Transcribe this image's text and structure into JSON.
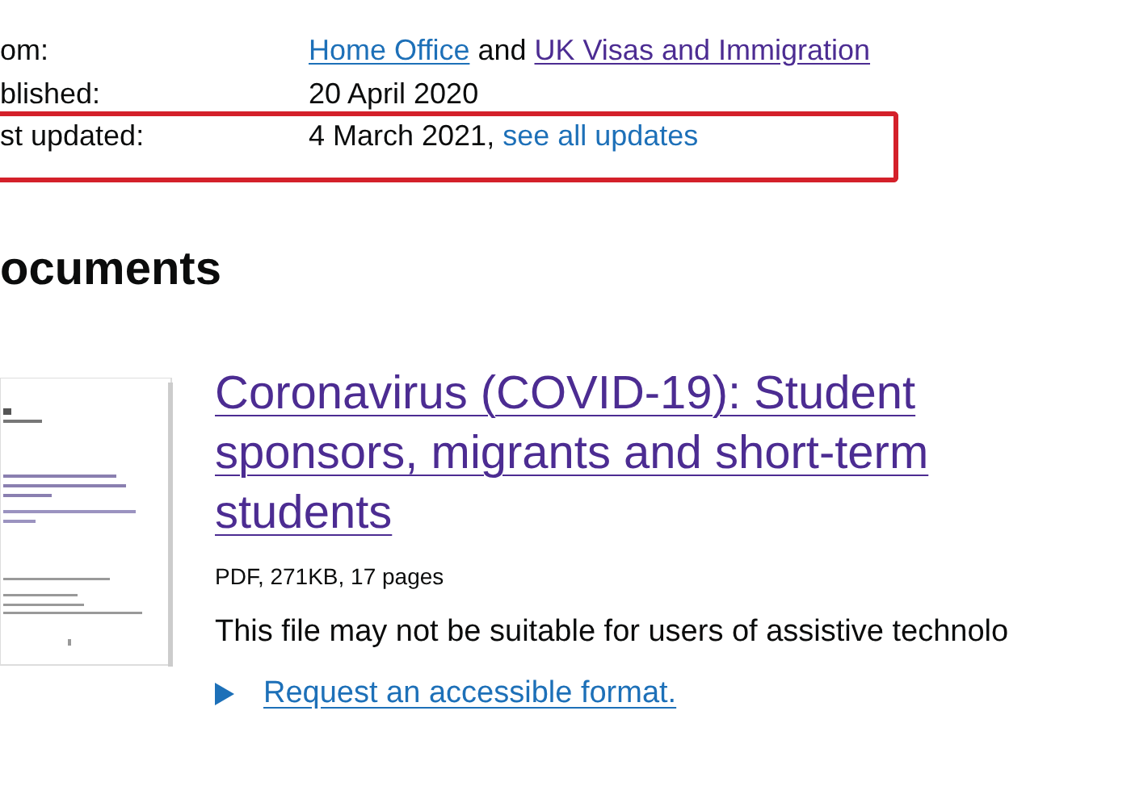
{
  "metadata": [
    {
      "label": "om:",
      "highlighted": false,
      "parts": [
        {
          "kind": "link",
          "text": "Home Office",
          "visited": false
        },
        {
          "kind": "text",
          "text": "and"
        },
        {
          "kind": "link",
          "text": "UK Visas and Immigration",
          "visited": true
        }
      ]
    },
    {
      "label": "blished:",
      "highlighted": false,
      "parts": [
        {
          "kind": "text",
          "text": "20 April 2020"
        }
      ]
    },
    {
      "label": "st updated:",
      "highlighted": true,
      "parts": [
        {
          "kind": "text",
          "text": "4 March 2021,"
        },
        {
          "kind": "link",
          "text": "see all updates",
          "visited": false
        }
      ]
    }
  ],
  "documents": {
    "heading": "ocuments",
    "items": [
      {
        "title": "Coronavirus (COVID-19): Student sponsors, migrants and short-term students",
        "title_visited": true,
        "meta": "PDF, 271KB, 17 pages",
        "notice": "This file may not be suitable for users of assistive technolo",
        "request_link": "Request an accessible format."
      }
    ]
  }
}
